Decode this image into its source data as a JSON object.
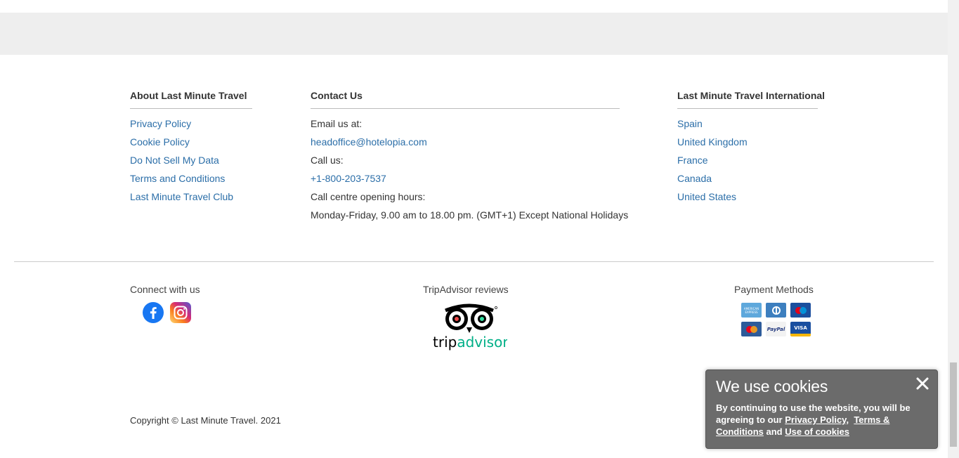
{
  "about": {
    "heading": "About Last Minute Travel",
    "links": [
      "Privacy Policy",
      "Cookie Policy",
      "Do Not Sell My Data",
      "Terms and Conditions",
      "Last Minute Travel Club"
    ]
  },
  "contact": {
    "heading": "Contact Us",
    "email_label": "Email us at:",
    "email": "headoffice@hotelopia.com",
    "call_label": "Call us:",
    "phone": "+1-800-203-7537",
    "hours_label": "Call centre opening hours:",
    "hours": "Monday-Friday, 9.00 am to 18.00 pm. (GMT+1) Except National Holidays"
  },
  "international": {
    "heading": "Last Minute Travel International",
    "links": [
      "Spain",
      "United Kingdom",
      "France",
      "Canada",
      "United States"
    ]
  },
  "connect": {
    "title": "Connect with us",
    "icons": [
      "facebook-icon",
      "instagram-icon"
    ]
  },
  "tripadvisor": {
    "title": "TripAdvisor reviews",
    "logo_text": "tripadvisor"
  },
  "payment": {
    "title": "Payment Methods",
    "cards": [
      {
        "name": "american-express",
        "label": "AMERICAN EXPRESS",
        "color": "#5ea8dc"
      },
      {
        "name": "diners-club",
        "label": "D",
        "color": "#3d7fbf"
      },
      {
        "name": "maestro",
        "label": "",
        "color": "#1b4f9e"
      },
      {
        "name": "mastercard",
        "label": "",
        "color": "#2d5b9a"
      },
      {
        "name": "paypal",
        "label": "PayPal",
        "color": "#f2f2f2"
      },
      {
        "name": "visa",
        "label": "VISA",
        "color": "#1a4fa0"
      }
    ]
  },
  "copyright": "Copyright © Last Minute Travel. 2021",
  "cookie": {
    "title": "We use cookies",
    "text_before": "By continuing to use the website, you will be agreeing to our ",
    "privacy_link": "Privacy Policy",
    "comma": ",",
    "terms_link": "Terms & Conditions",
    "and_text": " and ",
    "use_link": "Use of cookies"
  },
  "colors": {
    "link": "#2b6ea8",
    "cookie_bg": "#6b6b6b",
    "band": "#eeeeee"
  }
}
